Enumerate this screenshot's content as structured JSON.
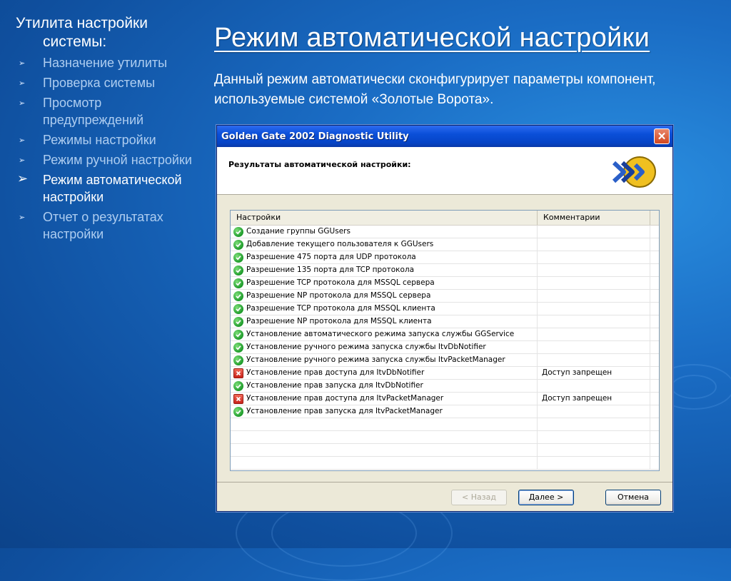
{
  "sidebar": {
    "title_line1": "Утилита настройки",
    "title_line2": "системы:",
    "items": [
      {
        "label": "Назначение утилиты"
      },
      {
        "label": "Проверка системы"
      },
      {
        "label": "Просмотр предупреждений"
      },
      {
        "label": "Режимы настройки"
      },
      {
        "label": "Режим ручной настройки"
      },
      {
        "label": "Режим автоматической настройки",
        "active": true
      },
      {
        "label": "Отчет о результатах настройки"
      }
    ]
  },
  "main": {
    "title": "Режим автоматической настройки",
    "intro": "Данный режим автоматически сконфигурирует параметры компонент, используемые системой «Золотые Ворота»."
  },
  "dialog": {
    "title": "Golden Gate 2002 Diagnostic Utility",
    "header_text": "Результаты автоматической настройки:",
    "columns": [
      "Настройки",
      "Комментарии"
    ],
    "rows": [
      {
        "status": "ok",
        "text": "Создание группы GGUsers",
        "comment": ""
      },
      {
        "status": "ok",
        "text": "Добавление текущего пользователя к GGUsers",
        "comment": ""
      },
      {
        "status": "ok",
        "text": "Разрешение 475 порта для UDP протокола",
        "comment": ""
      },
      {
        "status": "ok",
        "text": "Разрешение 135 порта для TCP протокола",
        "comment": ""
      },
      {
        "status": "ok",
        "text": "Разрешение TCP протокола для MSSQL сервера",
        "comment": ""
      },
      {
        "status": "ok",
        "text": "Разрешение NP протокола для MSSQL сервера",
        "comment": ""
      },
      {
        "status": "ok",
        "text": "Разрешение TCP протокола для MSSQL клиента",
        "comment": ""
      },
      {
        "status": "ok",
        "text": "Разрешение NP протокола для MSSQL клиента",
        "comment": ""
      },
      {
        "status": "ok",
        "text": "Установление автоматического режима  запуска службы GGService",
        "comment": ""
      },
      {
        "status": "ok",
        "text": "Установление ручного режима запуска службы ItvDbNotifier",
        "comment": ""
      },
      {
        "status": "ok",
        "text": "Установление ручного режима запуска службы ItvPacketManager",
        "comment": ""
      },
      {
        "status": "err",
        "text": "Установление прав доступа для ItvDbNotifier",
        "comment": "Доступ запрещен"
      },
      {
        "status": "ok",
        "text": "Установление прав запуска для ItvDbNotifier",
        "comment": ""
      },
      {
        "status": "err",
        "text": "Установление прав доступа для ItvPacketManager",
        "comment": "Доступ запрещен"
      },
      {
        "status": "ok",
        "text": "Установление прав запуска для ItvPacketManager",
        "comment": ""
      }
    ],
    "buttons": {
      "back": "< Назад",
      "next": "Далее >",
      "cancel": "Отмена"
    },
    "colors": {
      "ok": "#1d9a2a",
      "error": "#c8221a",
      "titlebar": "#0a4fd8"
    }
  }
}
